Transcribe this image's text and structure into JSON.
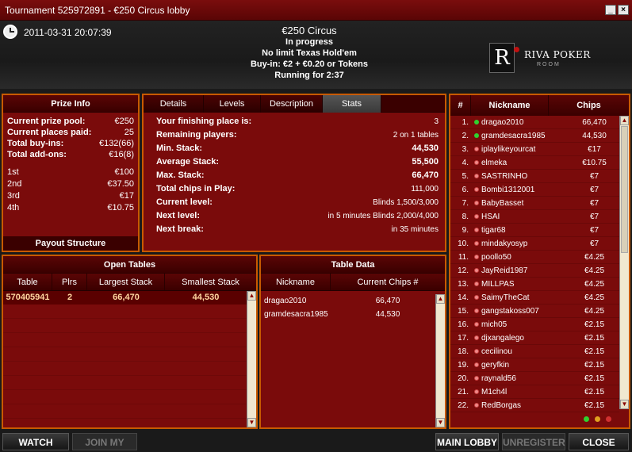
{
  "window": {
    "title": "Tournament 525972891 - €250 Circus lobby",
    "minimize_label": "_",
    "close_label": "×"
  },
  "header": {
    "datetime": "2011-03-31 20:07:39",
    "tournament_name": "€250 Circus",
    "status": "In progress",
    "game": "No limit Texas Hold'em",
    "buyin": "Buy-in: €2 + €0.20 or Tokens",
    "running": "Running for 2:37",
    "logo_mark": "R",
    "logo_brand": "RIVA POKER",
    "logo_sub": "ROOM"
  },
  "prize_info": {
    "title": "Prize Info",
    "rows": [
      {
        "label": "Current prize pool:",
        "value": "€250"
      },
      {
        "label": "Current places paid:",
        "value": "25"
      },
      {
        "label": "Total buy-ins:",
        "value": "€132(66)"
      },
      {
        "label": "Total add-ons:",
        "value": "€16(8)"
      }
    ],
    "places": [
      {
        "label": "1st",
        "value": "€100"
      },
      {
        "label": "2nd",
        "value": "€37.50"
      },
      {
        "label": "3rd",
        "value": "€17"
      },
      {
        "label": "4th",
        "value": "€10.75"
      }
    ],
    "footer": "Payout Structure"
  },
  "stats": {
    "tabs": [
      "Details",
      "Levels",
      "Description",
      "Stats"
    ],
    "active_tab": "Stats",
    "rows": [
      {
        "label": "Your finishing place is:",
        "value": "3"
      },
      {
        "label": "Remaining players:",
        "value": "2 on 1 tables"
      },
      {
        "label": "Min. Stack:",
        "value": "44,530"
      },
      {
        "label": "Average Stack:",
        "value": "55,500"
      },
      {
        "label": "Max. Stack:",
        "value": "66,470"
      },
      {
        "label": "Total chips in Play:",
        "value": "111,000"
      },
      {
        "label": "Current level:",
        "value": "Blinds 1,500/3,000"
      },
      {
        "label": "Next level:",
        "value": "in 5 minutes Blinds 2,000/4,000"
      },
      {
        "label": "Next break:",
        "value": "in 35 minutes"
      }
    ]
  },
  "players": {
    "headers": {
      "num": "#",
      "nick": "Nickname",
      "chips": "Chips"
    },
    "rows": [
      {
        "num": "1.",
        "nick": "dragao2010",
        "chips": "66,470",
        "status": "green"
      },
      {
        "num": "2.",
        "nick": "gramdesacra1985",
        "chips": "44,530",
        "status": "green"
      },
      {
        "num": "3.",
        "nick": "iplaylikeyourcat",
        "chips": "€17",
        "status": "red"
      },
      {
        "num": "4.",
        "nick": "elmeka",
        "chips": "€10.75",
        "status": "red"
      },
      {
        "num": "5.",
        "nick": "SASTRINHO",
        "chips": "€7",
        "status": "red"
      },
      {
        "num": "6.",
        "nick": "Bombi1312001",
        "chips": "€7",
        "status": "red"
      },
      {
        "num": "7.",
        "nick": "BabyBasset",
        "chips": "€7",
        "status": "red"
      },
      {
        "num": "8.",
        "nick": "HSAI",
        "chips": "€7",
        "status": "red"
      },
      {
        "num": "9.",
        "nick": "tigar68",
        "chips": "€7",
        "status": "red"
      },
      {
        "num": "10.",
        "nick": "mindakyosyp",
        "chips": "€7",
        "status": "red"
      },
      {
        "num": "11.",
        "nick": "poollo50",
        "chips": "€4.25",
        "status": "red"
      },
      {
        "num": "12.",
        "nick": "JayReid1987",
        "chips": "€4.25",
        "status": "red"
      },
      {
        "num": "13.",
        "nick": "MILLPAS",
        "chips": "€4.25",
        "status": "red"
      },
      {
        "num": "14.",
        "nick": "SaimyTheCat",
        "chips": "€4.25",
        "status": "red"
      },
      {
        "num": "15.",
        "nick": "gangstakoss007",
        "chips": "€4.25",
        "status": "red"
      },
      {
        "num": "16.",
        "nick": "mich05",
        "chips": "€2.15",
        "status": "red"
      },
      {
        "num": "17.",
        "nick": "djxangalego",
        "chips": "€2.15",
        "status": "red"
      },
      {
        "num": "18.",
        "nick": "cecilinou",
        "chips": "€2.15",
        "status": "red"
      },
      {
        "num": "19.",
        "nick": "geryfkin",
        "chips": "€2.15",
        "status": "red"
      },
      {
        "num": "20.",
        "nick": "raynald56",
        "chips": "€2.15",
        "status": "red"
      },
      {
        "num": "21.",
        "nick": "M1ch4l",
        "chips": "€2.15",
        "status": "red"
      },
      {
        "num": "22.",
        "nick": "RedBorgas",
        "chips": "€2.15",
        "status": "red"
      }
    ]
  },
  "open_tables": {
    "title": "Open Tables",
    "headers": [
      "Table",
      "Plrs",
      "Largest Stack",
      "Smallest Stack"
    ],
    "rows": [
      {
        "table": "570405941",
        "plrs": "2",
        "largest": "66,470",
        "smallest": "44,530"
      }
    ]
  },
  "table_data": {
    "title": "Table Data",
    "headers": [
      "Nickname",
      "Current Chips #"
    ],
    "rows": [
      {
        "nick": "dragao2010",
        "chips": "66,470"
      },
      {
        "nick": "gramdesacra1985",
        "chips": "44,530"
      }
    ]
  },
  "buttons": {
    "watch_table": "WATCH TABLE",
    "join_my_table": "JOIN MY TABLE",
    "main_lobby": "MAIN LOBBY",
    "unregister": "UNREGISTER",
    "close": "CLOSE"
  },
  "colors": {
    "panel_bg": "#7a0b0b",
    "panel_border": "#c85a00",
    "online_dot": "#2fd12f"
  }
}
